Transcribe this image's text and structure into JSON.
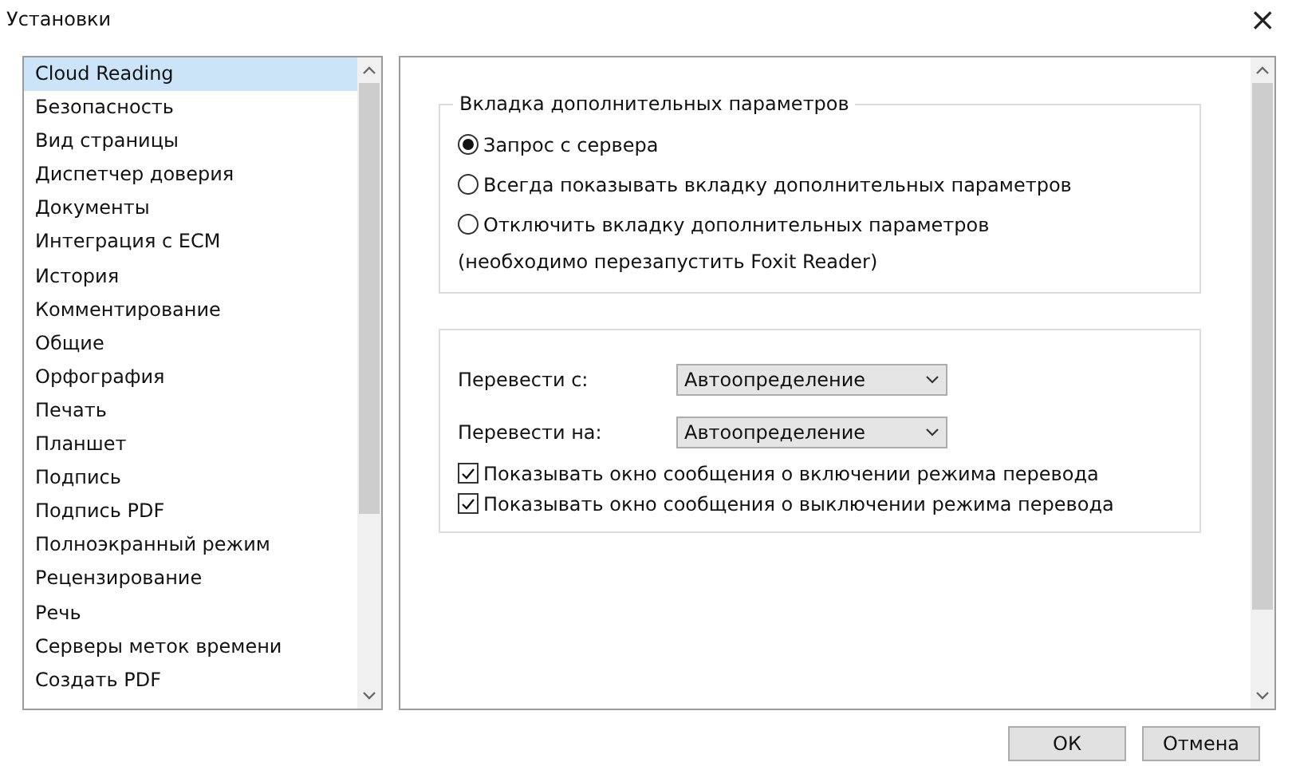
{
  "window": {
    "title": "Установки",
    "close": "×"
  },
  "categories": [
    {
      "label": "Cloud Reading",
      "selected": true
    },
    {
      "label": "Безопасность",
      "selected": false
    },
    {
      "label": "Вид страницы",
      "selected": false
    },
    {
      "label": "Диспетчер доверия",
      "selected": false
    },
    {
      "label": "Документы",
      "selected": false
    },
    {
      "label": "Интеграция с ECM",
      "selected": false
    },
    {
      "label": "История",
      "selected": false
    },
    {
      "label": "Комментирование",
      "selected": false
    },
    {
      "label": "Общие",
      "selected": false
    },
    {
      "label": "Орфография",
      "selected": false
    },
    {
      "label": "Печать",
      "selected": false
    },
    {
      "label": "Планшет",
      "selected": false
    },
    {
      "label": "Подпись",
      "selected": false
    },
    {
      "label": "Подпись PDF",
      "selected": false
    },
    {
      "label": "Полноэкранный режим",
      "selected": false
    },
    {
      "label": "Рецензирование",
      "selected": false
    },
    {
      "label": "Речь",
      "selected": false
    },
    {
      "label": "Серверы меток времени",
      "selected": false
    },
    {
      "label": "Создать PDF",
      "selected": false
    }
  ],
  "advanced_tab_group": {
    "title": "Вкладка дополнительных параметров",
    "options": [
      {
        "label": "Запрос с сервера",
        "selected": true
      },
      {
        "label": "Всегда показывать вкладку дополнительных параметров",
        "selected": false
      },
      {
        "label": "Отключить вкладку дополнительных параметров",
        "selected": false
      }
    ],
    "note": "(необходимо перезапустить Foxit Reader)"
  },
  "translate_group": {
    "fields": [
      {
        "label": "Перевести с:",
        "value": "Автоопределение"
      },
      {
        "label": "Перевести на:",
        "value": "Автоопределение"
      }
    ],
    "checkboxes": [
      {
        "label": "Показывать окно сообщения о включении режима перевода",
        "checked": true
      },
      {
        "label": "Показывать окно сообщения о выключении режима перевода",
        "checked": true
      }
    ]
  },
  "buttons": [
    "ОК",
    "Отмена"
  ]
}
